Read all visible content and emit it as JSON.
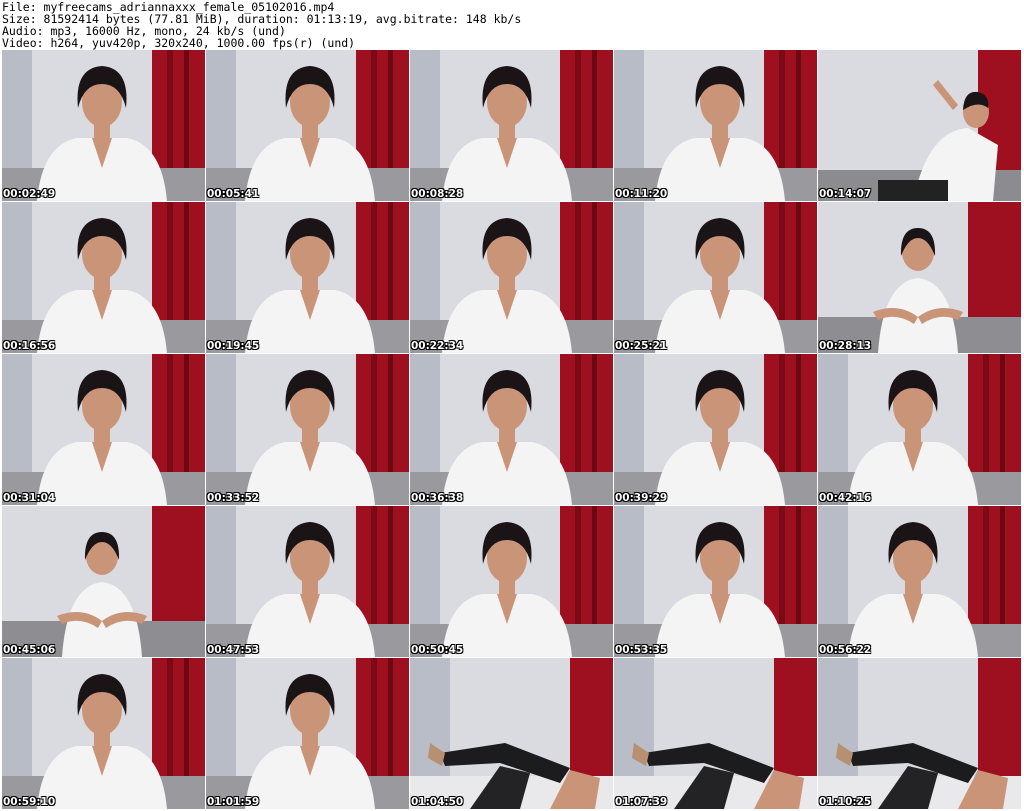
{
  "header": {
    "file_line": "File: myfreecams_adriannaxxx_female_05102016.mp4",
    "size_line": "Size: 81592414 bytes (77.81 MiB), duration: 01:13:19, avg.bitrate: 148 kb/s",
    "audio_line": "Audio: mp3, 16000 Hz, mono, 24 kb/s (und)",
    "video_line": "Video: h264, yuv420p, 320x240, 1000.00 fps(r) (und)"
  },
  "colors": {
    "curtain_red": "#9e1020",
    "backdrop_silver": "#d9dbe0",
    "blouse_white": "#f4f4f4",
    "hair_black": "#1a1416",
    "skin": "#c99478",
    "timestamp_text": "#ffffff"
  },
  "thumbnails": [
    {
      "time": "00:02:49",
      "scene": "portrait"
    },
    {
      "time": "00:05:41",
      "scene": "portrait"
    },
    {
      "time": "00:08:28",
      "scene": "portrait"
    },
    {
      "time": "00:11:20",
      "scene": "portrait"
    },
    {
      "time": "00:14:07",
      "scene": "reclining"
    },
    {
      "time": "00:16:56",
      "scene": "portrait"
    },
    {
      "time": "00:19:45",
      "scene": "portrait"
    },
    {
      "time": "00:22:34",
      "scene": "portrait"
    },
    {
      "time": "00:25:21",
      "scene": "portrait"
    },
    {
      "time": "00:28:13",
      "scene": "seated"
    },
    {
      "time": "00:31:04",
      "scene": "portrait"
    },
    {
      "time": "00:33:52",
      "scene": "portrait"
    },
    {
      "time": "00:36:38",
      "scene": "portrait"
    },
    {
      "time": "00:39:29",
      "scene": "portrait"
    },
    {
      "time": "00:42:16",
      "scene": "portrait"
    },
    {
      "time": "00:45:06",
      "scene": "seated"
    },
    {
      "time": "00:47:53",
      "scene": "portrait"
    },
    {
      "time": "00:50:45",
      "scene": "portrait"
    },
    {
      "time": "00:53:35",
      "scene": "portrait"
    },
    {
      "time": "00:56:22",
      "scene": "portrait"
    },
    {
      "time": "00:59:10",
      "scene": "portrait"
    },
    {
      "time": "01:01:59",
      "scene": "portrait"
    },
    {
      "time": "01:04:50",
      "scene": "legs"
    },
    {
      "time": "01:07:39",
      "scene": "legs"
    },
    {
      "time": "01:10:25",
      "scene": "legs"
    }
  ]
}
